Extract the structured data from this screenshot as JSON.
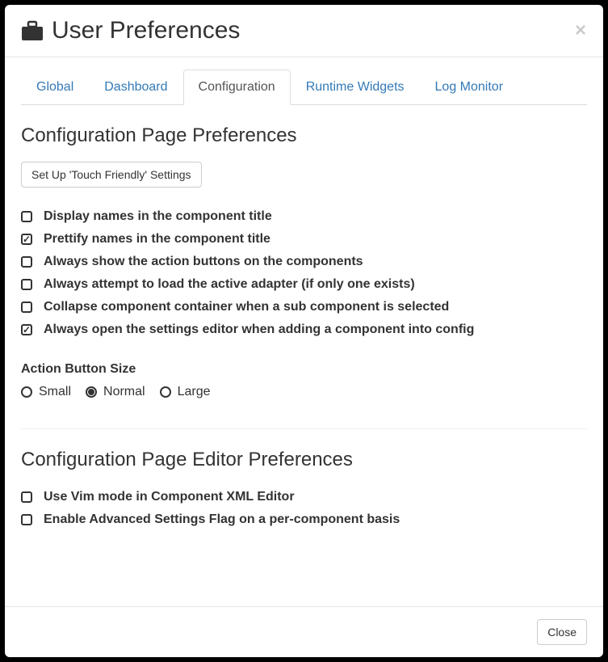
{
  "header": {
    "title": "User Preferences",
    "icon": "briefcase-icon"
  },
  "tabs": [
    {
      "label": "Global",
      "active": false
    },
    {
      "label": "Dashboard",
      "active": false
    },
    {
      "label": "Configuration",
      "active": true
    },
    {
      "label": "Runtime Widgets",
      "active": false
    },
    {
      "label": "Log Monitor",
      "active": false
    }
  ],
  "section1": {
    "title": "Configuration Page Preferences",
    "touch_button_label": "Set Up 'Touch Friendly' Settings",
    "options": [
      {
        "label": "Display names in the component title",
        "checked": false
      },
      {
        "label": "Prettify names in the component title",
        "checked": true
      },
      {
        "label": "Always show the action buttons on the components",
        "checked": false
      },
      {
        "label": "Always attempt to load the active adapter (if only one exists)",
        "checked": false
      },
      {
        "label": "Collapse component container when a sub component is selected",
        "checked": false
      },
      {
        "label": "Always open the settings editor when adding a component into config",
        "checked": true
      }
    ],
    "action_button_size_label": "Action Button Size",
    "sizes": [
      {
        "label": "Small",
        "checked": false
      },
      {
        "label": "Normal",
        "checked": true
      },
      {
        "label": "Large",
        "checked": false
      }
    ]
  },
  "section2": {
    "title": "Configuration Page Editor Preferences",
    "options": [
      {
        "label": "Use Vim mode in Component XML Editor",
        "checked": false
      },
      {
        "label": "Enable Advanced Settings Flag on a per-component basis",
        "checked": false
      }
    ]
  },
  "footer": {
    "close_label": "Close"
  }
}
